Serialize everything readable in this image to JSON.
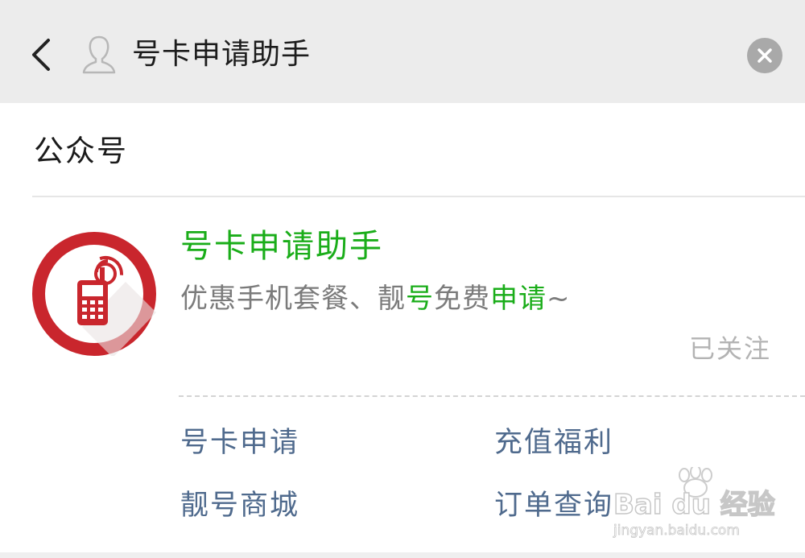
{
  "header": {
    "back_icon": "chevron-left-icon",
    "person_icon": "person-outline-icon",
    "search_value": "号卡申请助手",
    "clear_icon": "clear-circle-icon"
  },
  "section": {
    "title": "公众号"
  },
  "result": {
    "name": "号卡申请助手",
    "description_parts": [
      "优惠手机套餐、靓",
      "号",
      "免费",
      "申请",
      "~"
    ],
    "status": "已关注",
    "avatar_icon": "phone-signal-icon"
  },
  "menu": [
    {
      "label": "号卡申请"
    },
    {
      "label": "充值福利"
    },
    {
      "label": "靓号商城"
    },
    {
      "label": "订单查询"
    }
  ],
  "watermark": {
    "brand": "Bai du 经验",
    "url": "jingyan.baidu.com"
  },
  "colors": {
    "accent_green": "#1aad19",
    "menu_blue": "#4f6a8d",
    "avatar_red": "#c9262d",
    "topbar_bg": "#ececec"
  }
}
